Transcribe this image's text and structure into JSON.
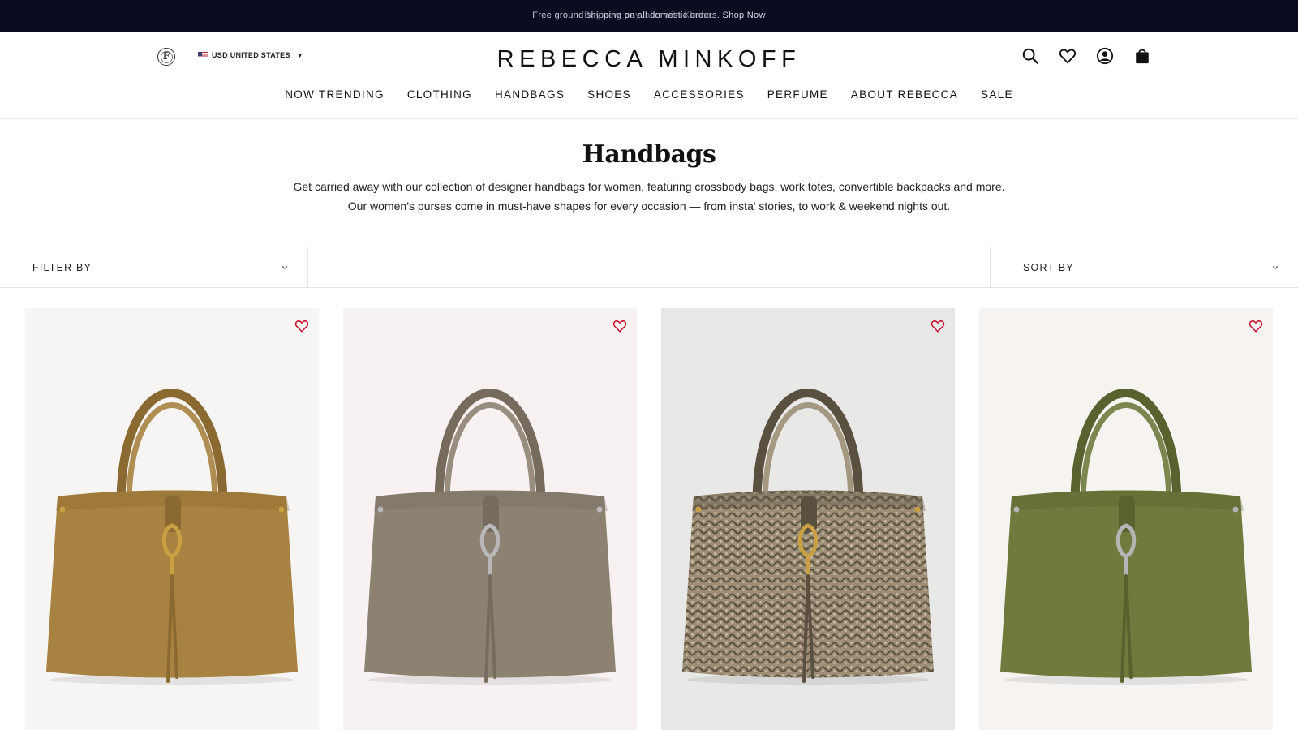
{
  "promo": {
    "text_primary": "Free ground shipping on all domestic orders.",
    "text_secondary": "Buy now, pay later with Klarna.",
    "link_label": "Shop Now"
  },
  "header": {
    "brand": "REBECCA MINKOFF",
    "locale_label": "USD UNITED STATES",
    "icons": [
      "search-icon",
      "heart-icon",
      "account-icon",
      "bag-icon"
    ]
  },
  "nav": [
    "NOW TRENDING",
    "CLOTHING",
    "HANDBAGS",
    "SHOES",
    "ACCESSORIES",
    "PERFUME",
    "ABOUT REBECCA",
    "SALE"
  ],
  "page": {
    "title": "Handbags",
    "intro_line1": "Get carried away with our collection of designer handbags for women, featuring crossbody bags, work totes, convertible backpacks and more.",
    "intro_line2": "Our women’s purses come in must-have shapes for every occasion — from insta' stories, to work & weekend nights out."
  },
  "filters": {
    "filter_label": "FILTER BY",
    "sort_label": "SORT BY"
  },
  "products": [
    {
      "bg": "#f6f5f3",
      "leather": "#a88240",
      "shade": "#8b6a31",
      "hardware": "#c9a043",
      "pattern": false
    },
    {
      "bg": "#f7f2f1",
      "leather": "#8d8272",
      "shade": "#766b5c",
      "hardware": "#b8b8b8",
      "pattern": false
    },
    {
      "bg": "#e8e8e7",
      "leather": "#9c8f76",
      "shade": "#5a5040",
      "hardware": "#c9a043",
      "pattern": true
    },
    {
      "bg": "#f6f3f1",
      "leather": "#6f7a3c",
      "shade": "#58622f",
      "hardware": "#b5b5b5",
      "pattern": false
    }
  ],
  "colors": {
    "promo_bg": "#0b0b22",
    "wishlist": "#c8102e"
  }
}
